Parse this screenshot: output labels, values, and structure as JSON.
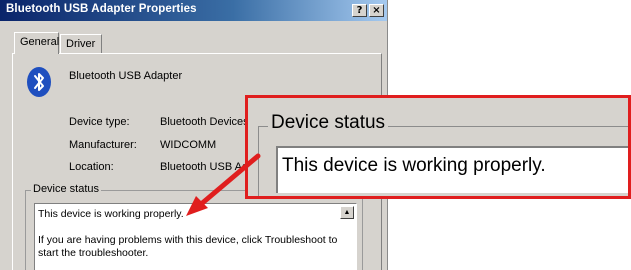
{
  "window": {
    "title": "Bluetooth USB Adapter Properties",
    "help_button": "?",
    "close_button": "×"
  },
  "tabs": [
    {
      "label": "General",
      "selected": true
    },
    {
      "label": "Driver",
      "selected": false
    }
  ],
  "device": {
    "icon": "bluetooth-icon",
    "name": "Bluetooth USB Adapter",
    "properties": [
      {
        "label": "Device type:",
        "value": "Bluetooth Devices"
      },
      {
        "label": "Manufacturer:",
        "value": "WIDCOMM"
      },
      {
        "label": "Location:",
        "value": "Bluetooth USB Ad"
      }
    ]
  },
  "status": {
    "group_title": "Device status",
    "lines": [
      "This device is working properly.",
      "If you are having problems with this device, click Troubleshoot to",
      "start the troubleshooter."
    ]
  },
  "zoom": {
    "group_title": "Device status",
    "text": "This device is working properly.",
    "border_color": "#e01e1e"
  }
}
